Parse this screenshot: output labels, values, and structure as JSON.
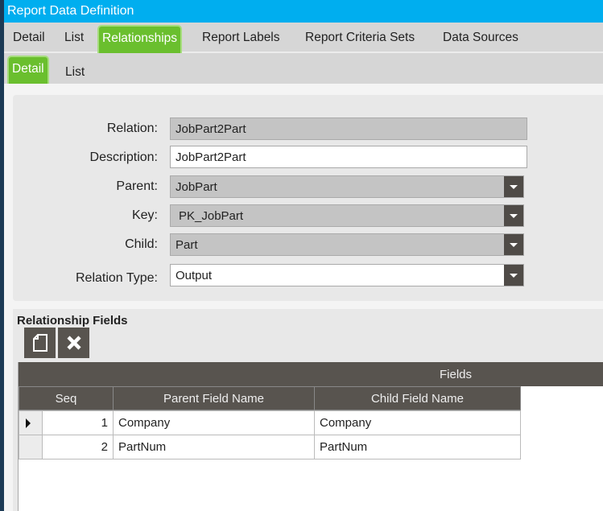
{
  "window": {
    "title": "Report Data Definition"
  },
  "tabs": [
    "Detail",
    "List",
    "Relationships",
    "Report Labels",
    "Report Criteria Sets",
    "Data Sources"
  ],
  "subtabs": [
    "Detail",
    "List"
  ],
  "form": {
    "relation_label": "Relation:",
    "relation": "JobPart2Part",
    "description_label": "Description:",
    "description": "JobPart2Part",
    "parent_label": "Parent:",
    "parent": "JobPart",
    "key_label": "Key:",
    "key": "PK_JobPart",
    "child_label": "Child:",
    "child": "Part",
    "relation_type_label": "Relation Type:",
    "relation_type": "Output"
  },
  "fields": {
    "title": "Relationship Fields",
    "group_header": "Fields",
    "columns": [
      "Seq",
      "Parent Field Name",
      "Child Field Name"
    ],
    "rows": [
      {
        "seq": "1",
        "parent": "Company",
        "child": "Company"
      },
      {
        "seq": "2",
        "parent": "PartNum",
        "child": "PartNum"
      }
    ]
  }
}
